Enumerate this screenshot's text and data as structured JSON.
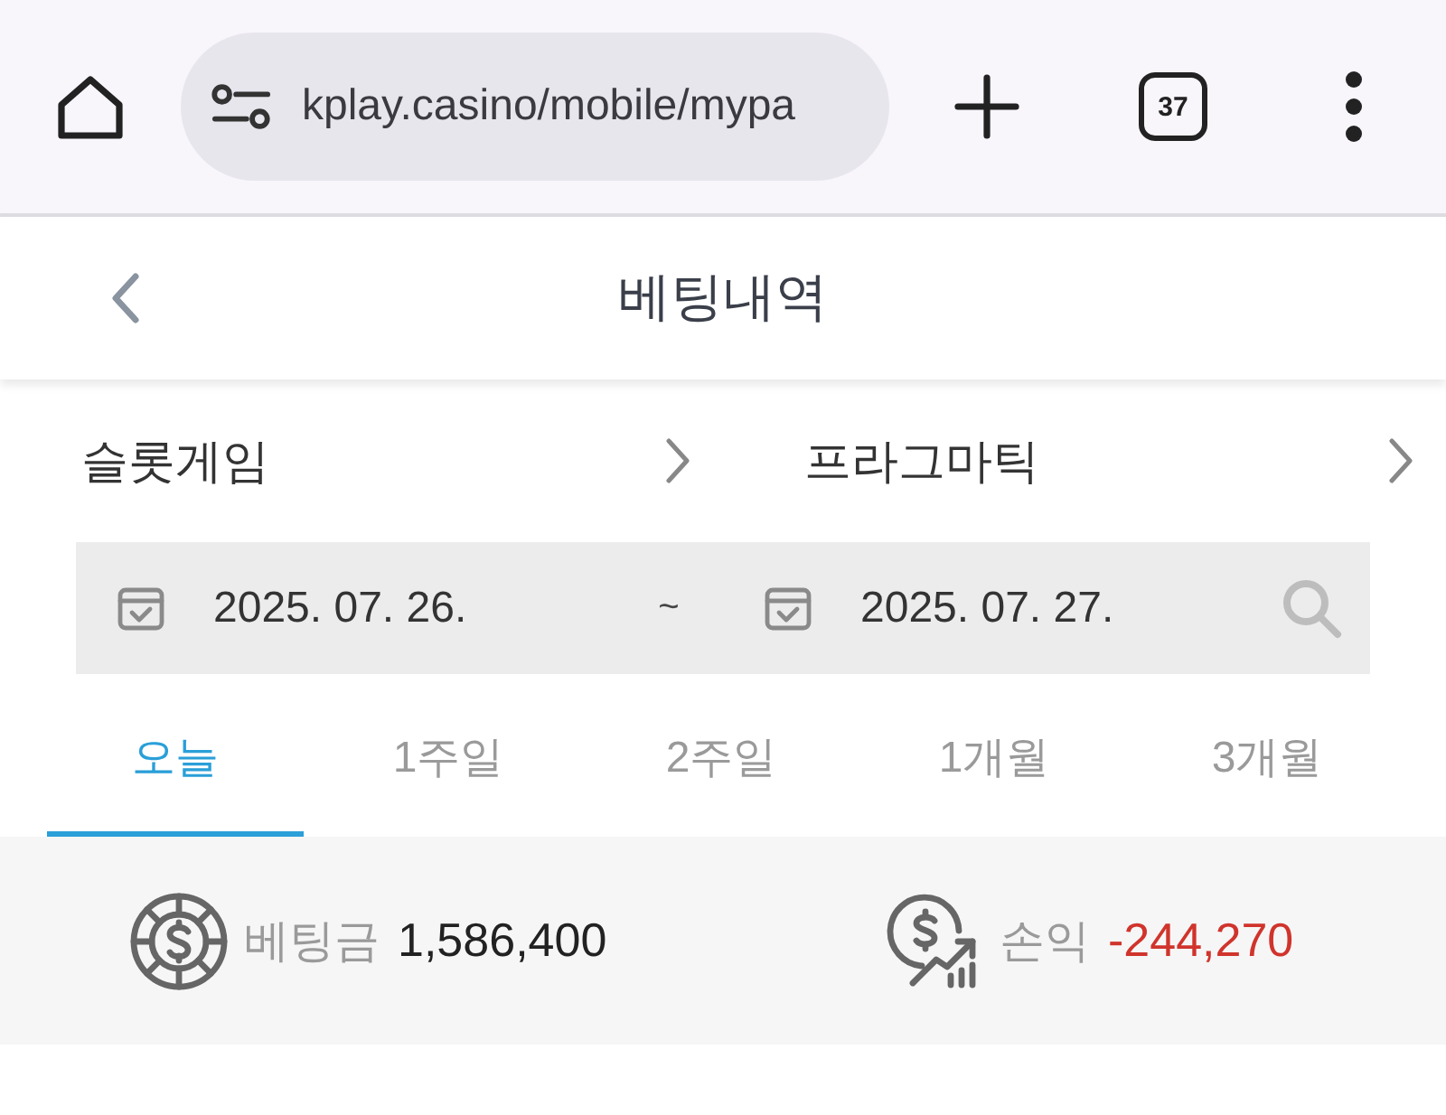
{
  "browser": {
    "url": "kplay.casino/mobile/mypa",
    "tab_count": "37"
  },
  "header": {
    "title": "베팅내역"
  },
  "filters": [
    {
      "label": "슬롯게임"
    },
    {
      "label": "프라그마틱"
    }
  ],
  "date_range": {
    "start": "2025. 07. 26.",
    "separator": "~",
    "end": "2025. 07. 27."
  },
  "periods": [
    {
      "label": "오늘",
      "selected": true
    },
    {
      "label": "1주일",
      "selected": false
    },
    {
      "label": "2주일",
      "selected": false
    },
    {
      "label": "1개월",
      "selected": false
    },
    {
      "label": "3개월",
      "selected": false
    }
  ],
  "summary": [
    {
      "kind": "bet",
      "label": "베팅금",
      "value": "1,586,400",
      "negative": false
    },
    {
      "kind": "profit",
      "label": "손익",
      "value": "-244,270",
      "negative": true
    }
  ]
}
